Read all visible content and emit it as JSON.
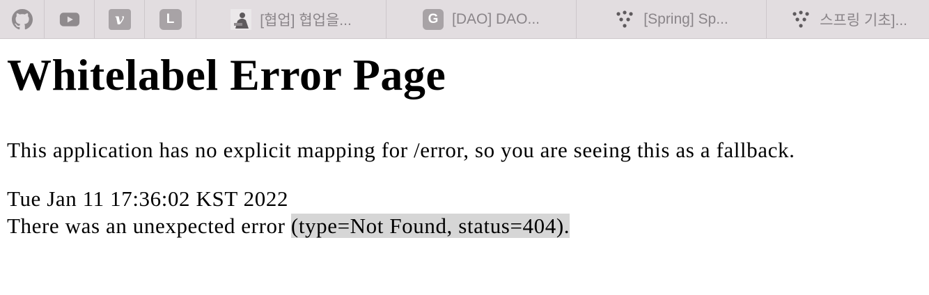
{
  "tabs": {
    "pinned": [
      {
        "icon": "github-icon"
      },
      {
        "icon": "youtube-icon"
      },
      {
        "icon": "velog-icon",
        "glyph": "v"
      },
      {
        "icon": "l-icon",
        "glyph": "L"
      }
    ],
    "items": [
      {
        "icon": "avatar-icon",
        "label": "[협업] 협업을..."
      },
      {
        "icon": "g-icon",
        "glyph": "G",
        "label": "[DAO] DAO..."
      },
      {
        "icon": "dots-icon",
        "label": "[Spring] Sp..."
      },
      {
        "icon": "dots-icon",
        "label": "스프링 기초]..."
      }
    ]
  },
  "page": {
    "title": "Whitelabel Error Page",
    "message": "This application has no explicit mapping for /error, so you are seeing this as a fallback.",
    "timestamp": "Tue Jan 11 17:36:02 KST 2022",
    "error_prefix": "There was an unexpected error ",
    "error_detail": "(type=Not Found, status=404)."
  },
  "colors": {
    "tabbar_bg": "#e2dde0",
    "icon_gray": "#a8a3a6",
    "highlight": "#d6d6d6"
  }
}
